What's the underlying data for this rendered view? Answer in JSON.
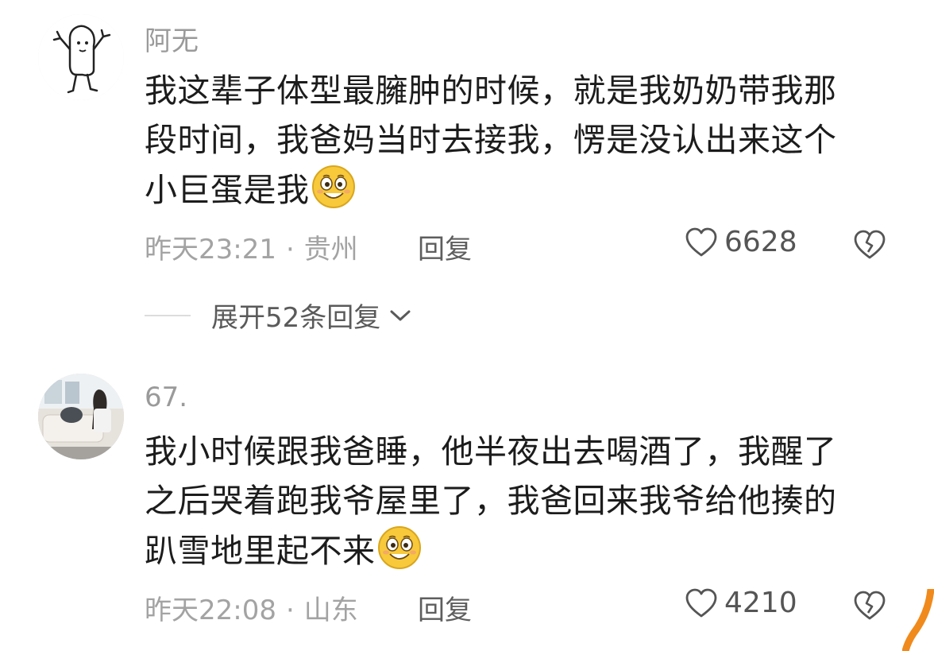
{
  "comments": [
    {
      "username": "阿无",
      "lines": [
        "我这辈子体型最臃肿的时候，就是我奶奶带我那",
        "段时间，我爸妈当时去接我，愣是没认出来这个",
        "小巨蛋是我"
      ],
      "time": "昨天23:21",
      "location": "贵州",
      "reply_label": "回复",
      "likes": "6628",
      "expand_label": "展开52条回复",
      "avatar": "doodle-figure",
      "emoji": "smiling-face-emoji"
    },
    {
      "username": "67.",
      "lines": [
        "我小时候跟我爸睡，他半夜出去喝酒了，我醒了",
        "之后哭着跑我爷屋里了，我爸回来我爷给他揍的",
        "趴雪地里起不来"
      ],
      "time": "昨天22:08",
      "location": "山东",
      "reply_label": "回复",
      "likes": "4210",
      "avatar": "room-photo",
      "emoji": "smiling-face-emoji"
    }
  ],
  "separator": "·",
  "colors": {
    "meta_text": "#a3a3a3",
    "body_text": "#1c1c1c",
    "emoji_face": "#f7c93b",
    "accent_orange": "#f08a1c"
  }
}
